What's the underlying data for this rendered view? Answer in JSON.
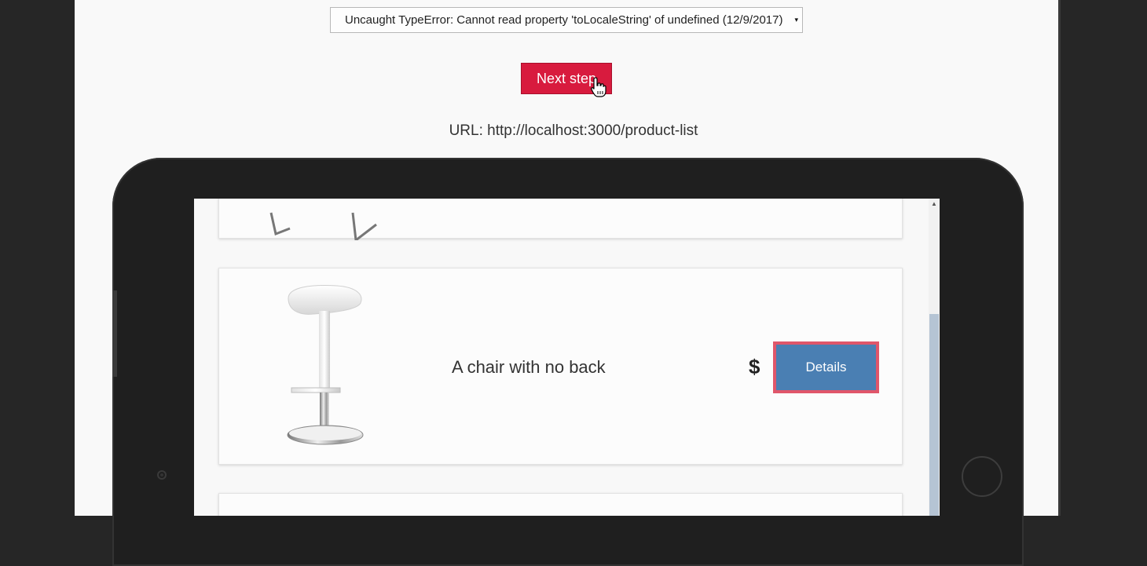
{
  "toolbar": {
    "error_select_value": "Uncaught TypeError: Cannot read property 'toLocaleString' of undefined (12/9/2017)",
    "dropdown_arrow": "▾",
    "next_step_label": "Next step",
    "url_text": "URL: http://localhost:3000/product-list"
  },
  "product_list": {
    "items": [
      {
        "name": "A chair with no back",
        "price": "$",
        "details_label": "Details"
      }
    ]
  },
  "scrollbar": {
    "up_arrow": "▲"
  },
  "colors": {
    "next_step_bg": "#d81b3e",
    "details_bg": "#4a7fb3",
    "details_highlight_border": "#e0566a"
  }
}
